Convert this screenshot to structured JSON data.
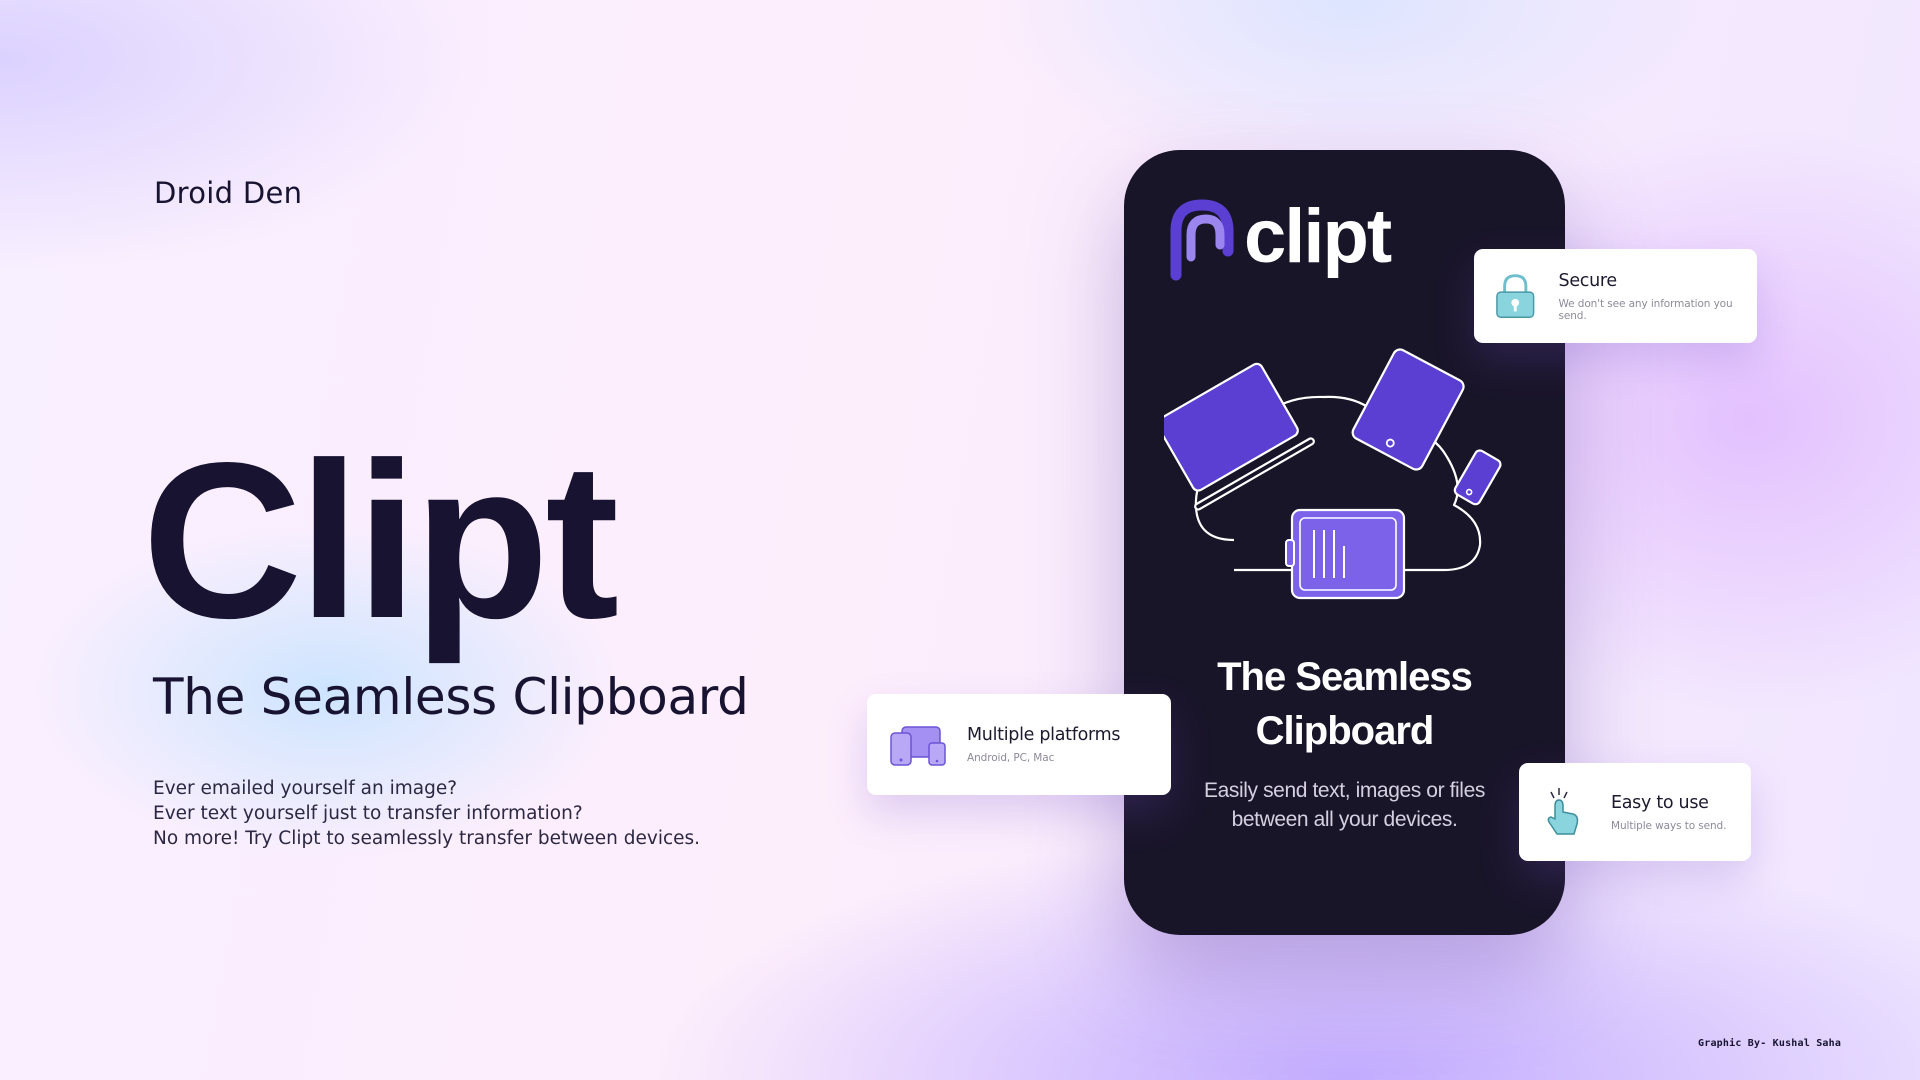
{
  "brand": {
    "name": "Droid Den"
  },
  "hero": {
    "title": "Clipt",
    "subtitle": "The Seamless Clipboard",
    "body": [
      "Ever emailed yourself an image?",
      "Ever text yourself just to transfer information?",
      "No more! Try Clipt to seamlessly transfer between devices."
    ]
  },
  "phone": {
    "logo_text": "clipt",
    "logo_icon": "clip-logo-icon",
    "illustration_icon": "devices-cloud-icon",
    "title_line1": "The Seamless",
    "title_line2": "Clipboard",
    "desc_line1": "Easily send text, images or files",
    "desc_line2": "between all your devices."
  },
  "features": {
    "secure": {
      "title": "Secure",
      "desc": "We don't see any information you send.",
      "icon": "lock-icon"
    },
    "multi": {
      "title": "Multiple platforms",
      "desc": "Android, PC, Mac",
      "icon": "devices-icon"
    },
    "easy": {
      "title": "Easy to use",
      "desc": "Multiple ways to send.",
      "icon": "tap-hand-icon"
    }
  },
  "credit": "Graphic By- Kushal Saha",
  "colors": {
    "text_dark": "#171330",
    "phone_bg": "#191529",
    "accent_purple": "#5b3fd3",
    "accent_purple_light": "#9b86f0",
    "icon_teal": "#8ad4dd"
  }
}
